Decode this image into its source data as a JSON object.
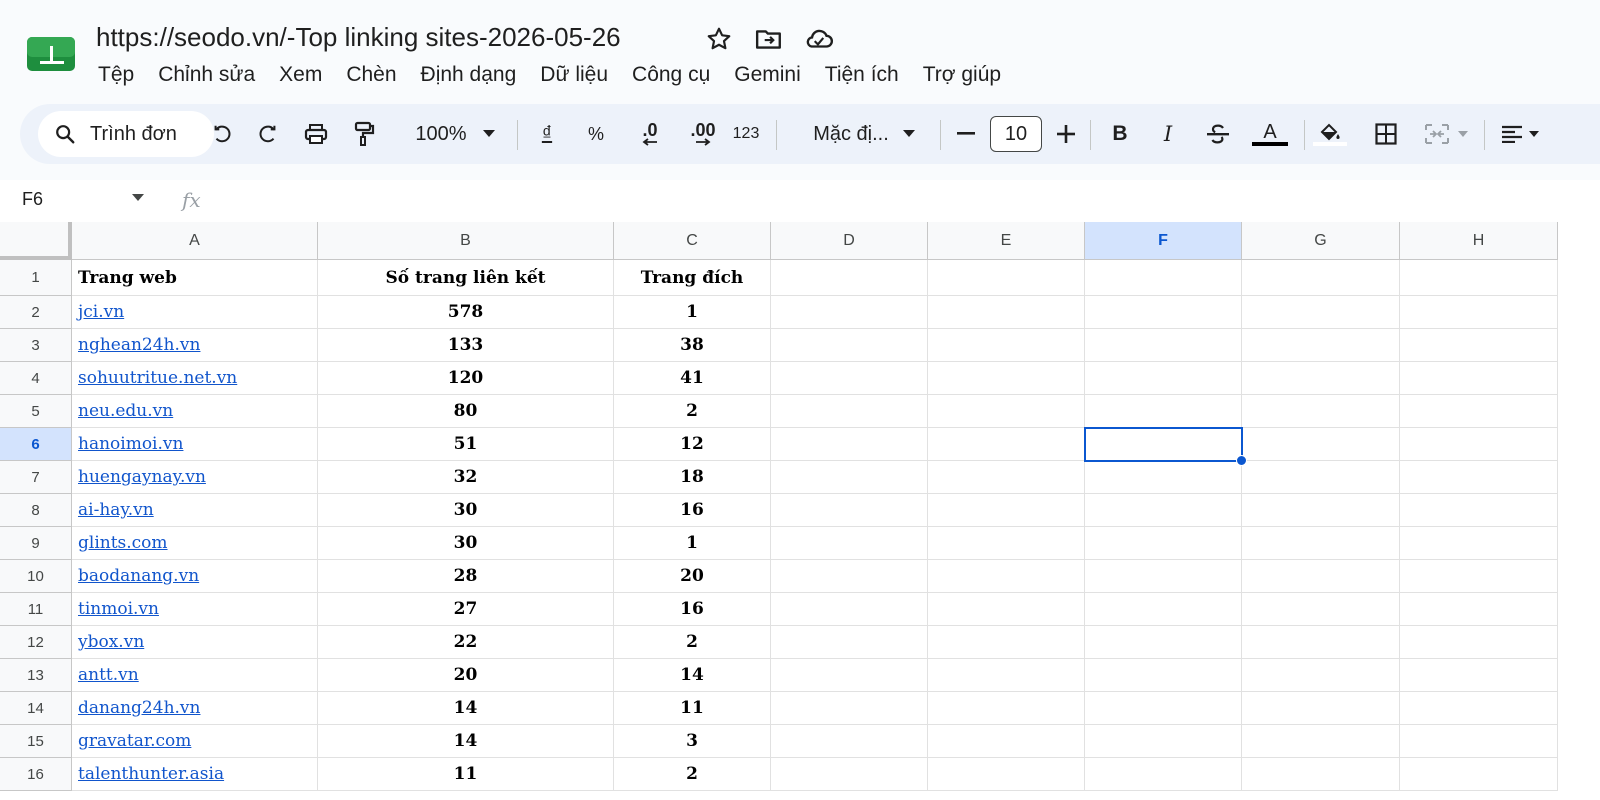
{
  "document": {
    "title": "https://seodo.vn/-Top linking sites-2026-05-26"
  },
  "menu": [
    "Tệp",
    "Chỉnh sửa",
    "Xem",
    "Chèn",
    "Định dạng",
    "Dữ liệu",
    "Công cụ",
    "Gemini",
    "Tiện ích",
    "Trợ giúp"
  ],
  "toolbar": {
    "menu_search_label": "Trình đơn",
    "zoom": "100%",
    "currency_symbol": "₫",
    "percent_symbol": "%",
    "decrease_decimal": ".0",
    "increase_decimal": ".00",
    "number_format": "123",
    "font_name": "Mặc đị...",
    "font_size": "10",
    "bold": "B",
    "italic": "I",
    "text_color_letter": "A"
  },
  "formula_bar": {
    "cell_ref": "F6",
    "fx_label": "fx"
  },
  "sheet": {
    "columns": [
      "A",
      "B",
      "C",
      "D",
      "E",
      "F",
      "G",
      "H"
    ],
    "selected_column": "F",
    "selected_row": "6",
    "header_row": [
      "Trang web",
      "Số trang liên kết",
      "Trang đích"
    ],
    "rows": [
      [
        "jci.vn",
        "578",
        "1"
      ],
      [
        "nghean24h.vn",
        "133",
        "38"
      ],
      [
        "sohuutritue.net.vn",
        "120",
        "41"
      ],
      [
        "neu.edu.vn",
        "80",
        "2"
      ],
      [
        "hanoimoi.vn",
        "51",
        "12"
      ],
      [
        "huengaynay.vn",
        "32",
        "18"
      ],
      [
        "ai-hay.vn",
        "30",
        "16"
      ],
      [
        "glints.com",
        "30",
        "1"
      ],
      [
        "baodanang.vn",
        "28",
        "20"
      ],
      [
        "tinmoi.vn",
        "27",
        "16"
      ],
      [
        "ybox.vn",
        "22",
        "2"
      ],
      [
        "antt.vn",
        "20",
        "14"
      ],
      [
        "danang24h.vn",
        "14",
        "11"
      ],
      [
        "gravatar.com",
        "14",
        "3"
      ],
      [
        "talenthunter.asia",
        "11",
        "2"
      ]
    ]
  },
  "colors": {
    "selection": "#0b57d0",
    "link": "#1155cc",
    "header_bg": "#f9fbfd",
    "toolbar_bg": "#edf2fa"
  }
}
